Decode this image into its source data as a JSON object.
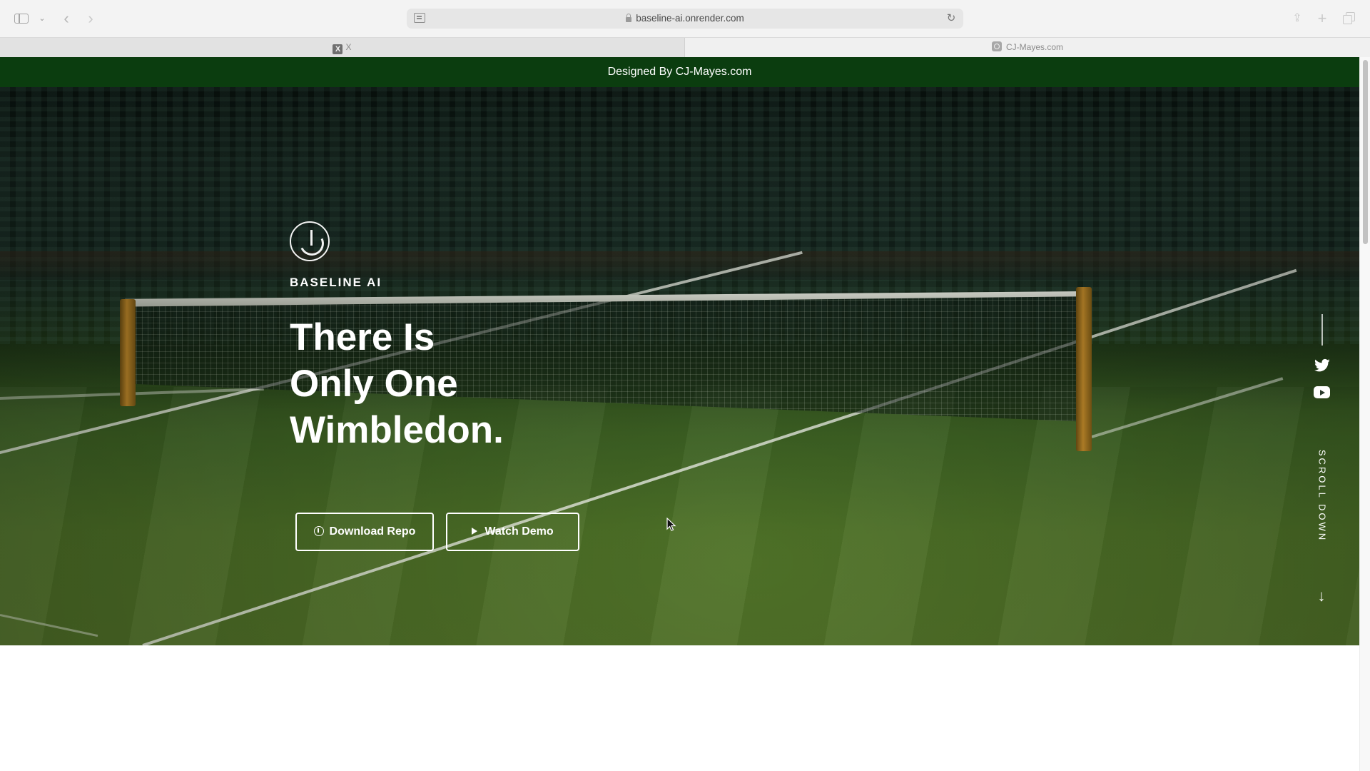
{
  "browser": {
    "url": "baseline-ai.onrender.com",
    "tabs": [
      {
        "label": "X",
        "favicon": "x-logo-icon"
      },
      {
        "label": "CJ-Mayes.com",
        "favicon": "site-icon"
      }
    ],
    "tab_close": "×"
  },
  "banner": {
    "text": "Designed By CJ-Mayes.com",
    "color": "#0b3d0f"
  },
  "hero": {
    "brand": "BASELINE AI",
    "headline_lines": [
      "There Is",
      "Only One",
      "Wimbledon."
    ],
    "buttons": {
      "download": "Download Repo",
      "demo": "Watch Demo"
    },
    "scroll_label": "SCROLL DOWN",
    "social": [
      "twitter-icon",
      "youtube-icon"
    ]
  }
}
